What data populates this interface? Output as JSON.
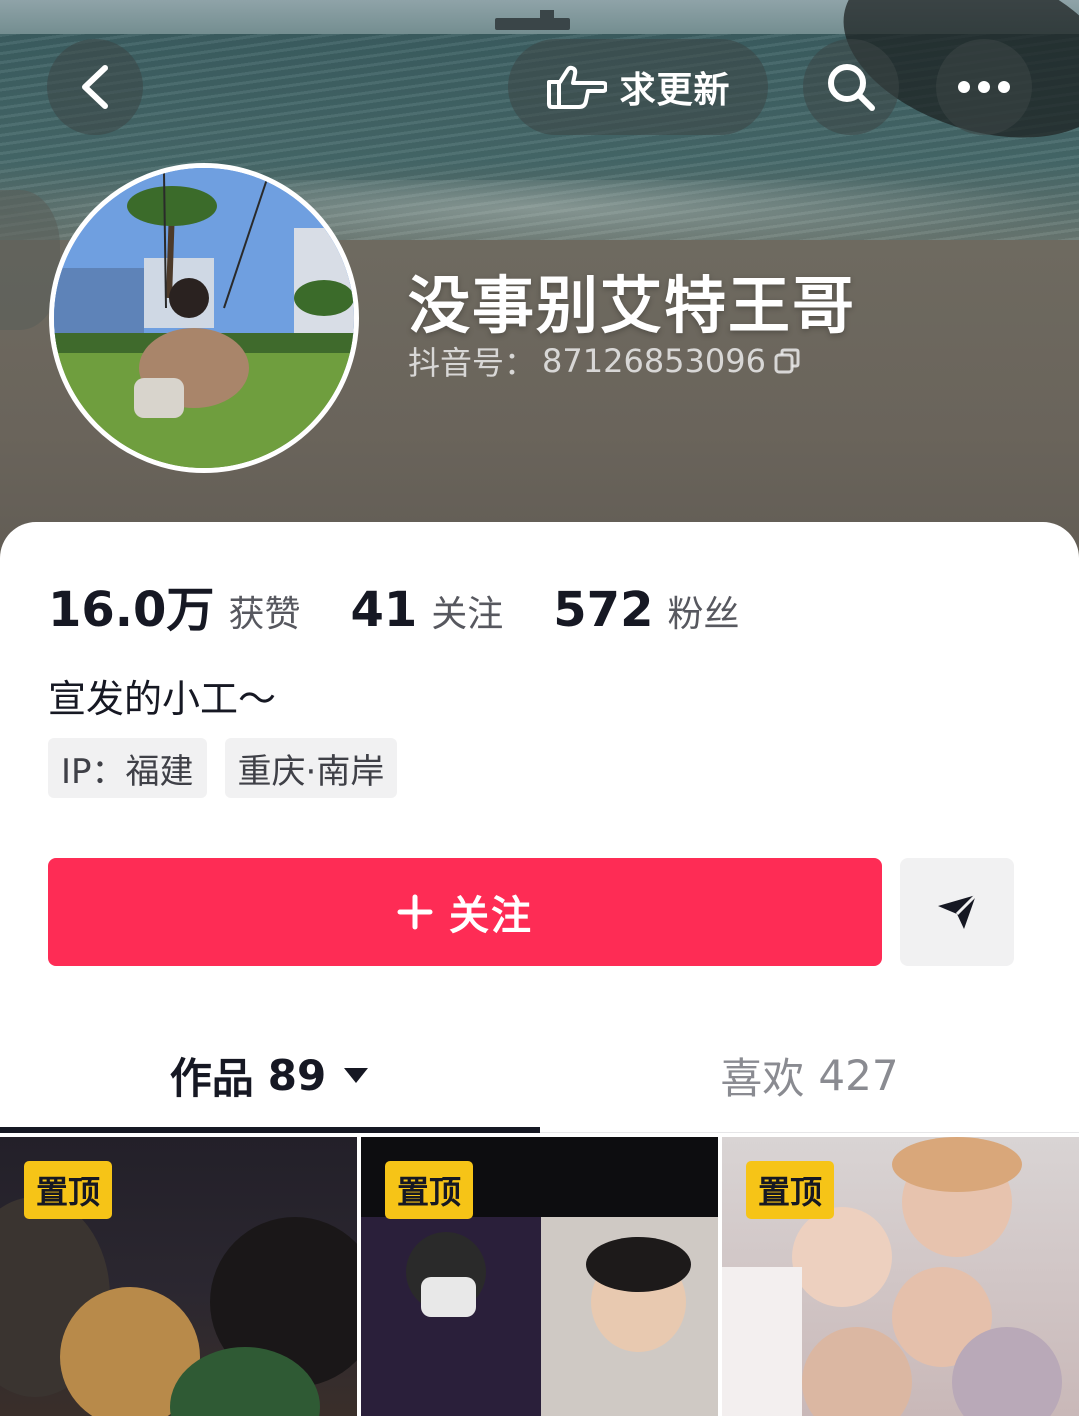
{
  "header": {
    "update_request_label": "求更新",
    "icons": [
      "back-arrow-icon",
      "pointing-hand-icon",
      "search-icon",
      "more-icon"
    ]
  },
  "profile": {
    "nickname": "没事别艾特王哥",
    "douyin_id_label": "抖音号：",
    "douyin_id": "87126853096",
    "bio": "宣发的小工～",
    "tags": [
      "IP：福建",
      "重庆·南岸"
    ]
  },
  "stats": {
    "likes": {
      "value": "16.0万",
      "label": "获赞"
    },
    "following": {
      "value": "41",
      "label": "关注"
    },
    "followers": {
      "value": "572",
      "label": "粉丝"
    }
  },
  "actions": {
    "follow_label": "关注",
    "follow_color": "#fe2c55"
  },
  "tabs": {
    "works": {
      "label": "作品",
      "count": "89"
    },
    "likes": {
      "label": "喜欢",
      "count": "427"
    }
  },
  "videos": [
    {
      "badge": "置顶"
    },
    {
      "badge": "置顶"
    },
    {
      "badge": "置顶"
    }
  ],
  "colors": {
    "badge": "#f6c417",
    "text_primary": "#161823"
  }
}
